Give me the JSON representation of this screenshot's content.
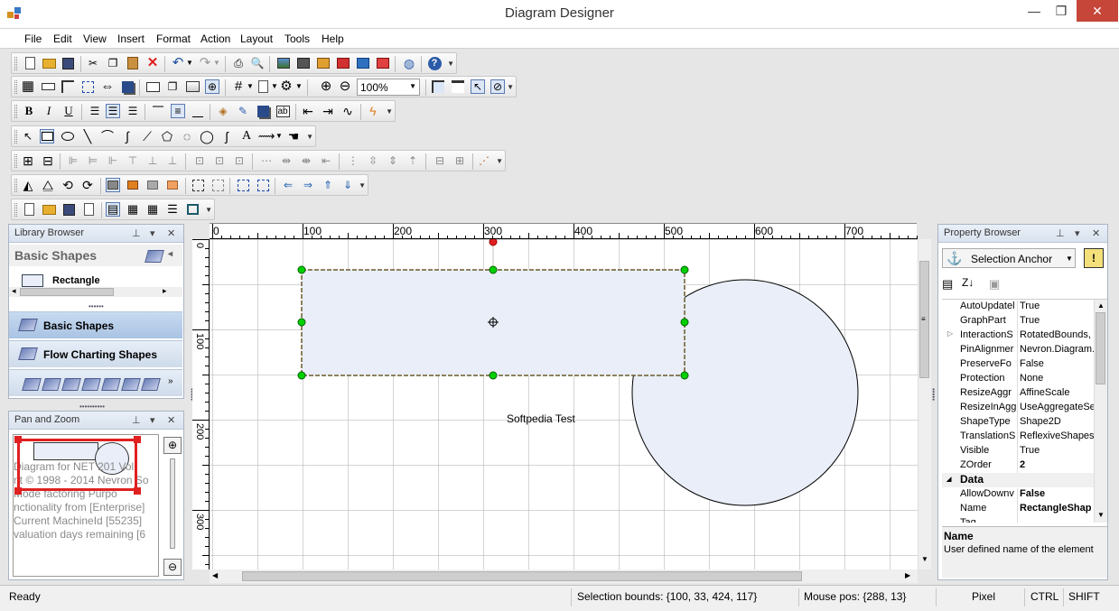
{
  "window": {
    "title": "Diagram Designer",
    "minimize": "—",
    "restore": "❐",
    "close": "✕"
  },
  "menu": [
    "File",
    "Edit",
    "View",
    "Insert",
    "Format",
    "Action",
    "Layout",
    "Tools",
    "Help"
  ],
  "toolbar": {
    "bold": "B",
    "italic": "I",
    "underline": "U",
    "zoom_value": "100%"
  },
  "library": {
    "title": "Library Browser",
    "header": "Basic Shapes",
    "item": "Rectangle",
    "categories": [
      "Basic Shapes",
      "Flow Charting Shapes"
    ]
  },
  "pan_zoom": {
    "title": "Pan and Zoom",
    "preview_lines": [
      "Diagram  for  NET 201  Vol",
      "nt © 1998 - 2014 Nevron So",
      "  Mode    factoring  Purpo",
      "nctionality from [Enterprise]",
      "Current MachineId [55235]",
      "valuation days remaining [6"
    ]
  },
  "ruler": {
    "top": [
      "0",
      "100",
      "200",
      "300",
      "400",
      "500",
      "600",
      "700"
    ],
    "left": [
      "0",
      "100",
      "200",
      "300"
    ]
  },
  "canvas": {
    "label": "Softpedia Test",
    "rect_fill": "#e9eef8",
    "handle_color": "#00d000",
    "rotate_handle_color": "#e02020"
  },
  "property_browser": {
    "title": "Property Browser",
    "selector": "Selection Anchor",
    "rows": [
      {
        "name": "AutoUpdatel",
        "value": "True",
        "bold": false
      },
      {
        "name": "GraphPart",
        "value": "True",
        "bold": false
      },
      {
        "name": "InteractionS",
        "value": "RotatedBounds,",
        "bold": false
      },
      {
        "name": "PinAlignmer",
        "value": "Nevron.Diagram.",
        "bold": false
      },
      {
        "name": "PreserveFo",
        "value": "False",
        "bold": false
      },
      {
        "name": "Protection",
        "value": "None",
        "bold": false
      },
      {
        "name": "ResizeAggr",
        "value": "AffineScale",
        "bold": false
      },
      {
        "name": "ResizeInAgg",
        "value": "UseAggregateSe",
        "bold": false
      },
      {
        "name": "ShapeType",
        "value": "Shape2D",
        "bold": false
      },
      {
        "name": "TranslationS",
        "value": "ReflexiveShapes",
        "bold": false
      },
      {
        "name": "Visible",
        "value": "True",
        "bold": false
      },
      {
        "name": "ZOrder",
        "value": "2",
        "bold": true
      }
    ],
    "category": "Data",
    "data_rows": [
      {
        "name": "AllowDownv",
        "value": "False",
        "bold": true
      },
      {
        "name": "Name",
        "value": "RectangleShap",
        "bold": true
      },
      {
        "name": "Tag",
        "value": "",
        "bold": false
      }
    ],
    "desc_title": "Name",
    "desc_text": "User defined name of the element"
  },
  "status": {
    "ready": "Ready",
    "selection": "Selection bounds: {100, 33, 424, 117}",
    "mouse": "Mouse pos: {288, 13}",
    "unit": "Pixel",
    "ctrl": "CTRL",
    "shift": "SHIFT"
  }
}
